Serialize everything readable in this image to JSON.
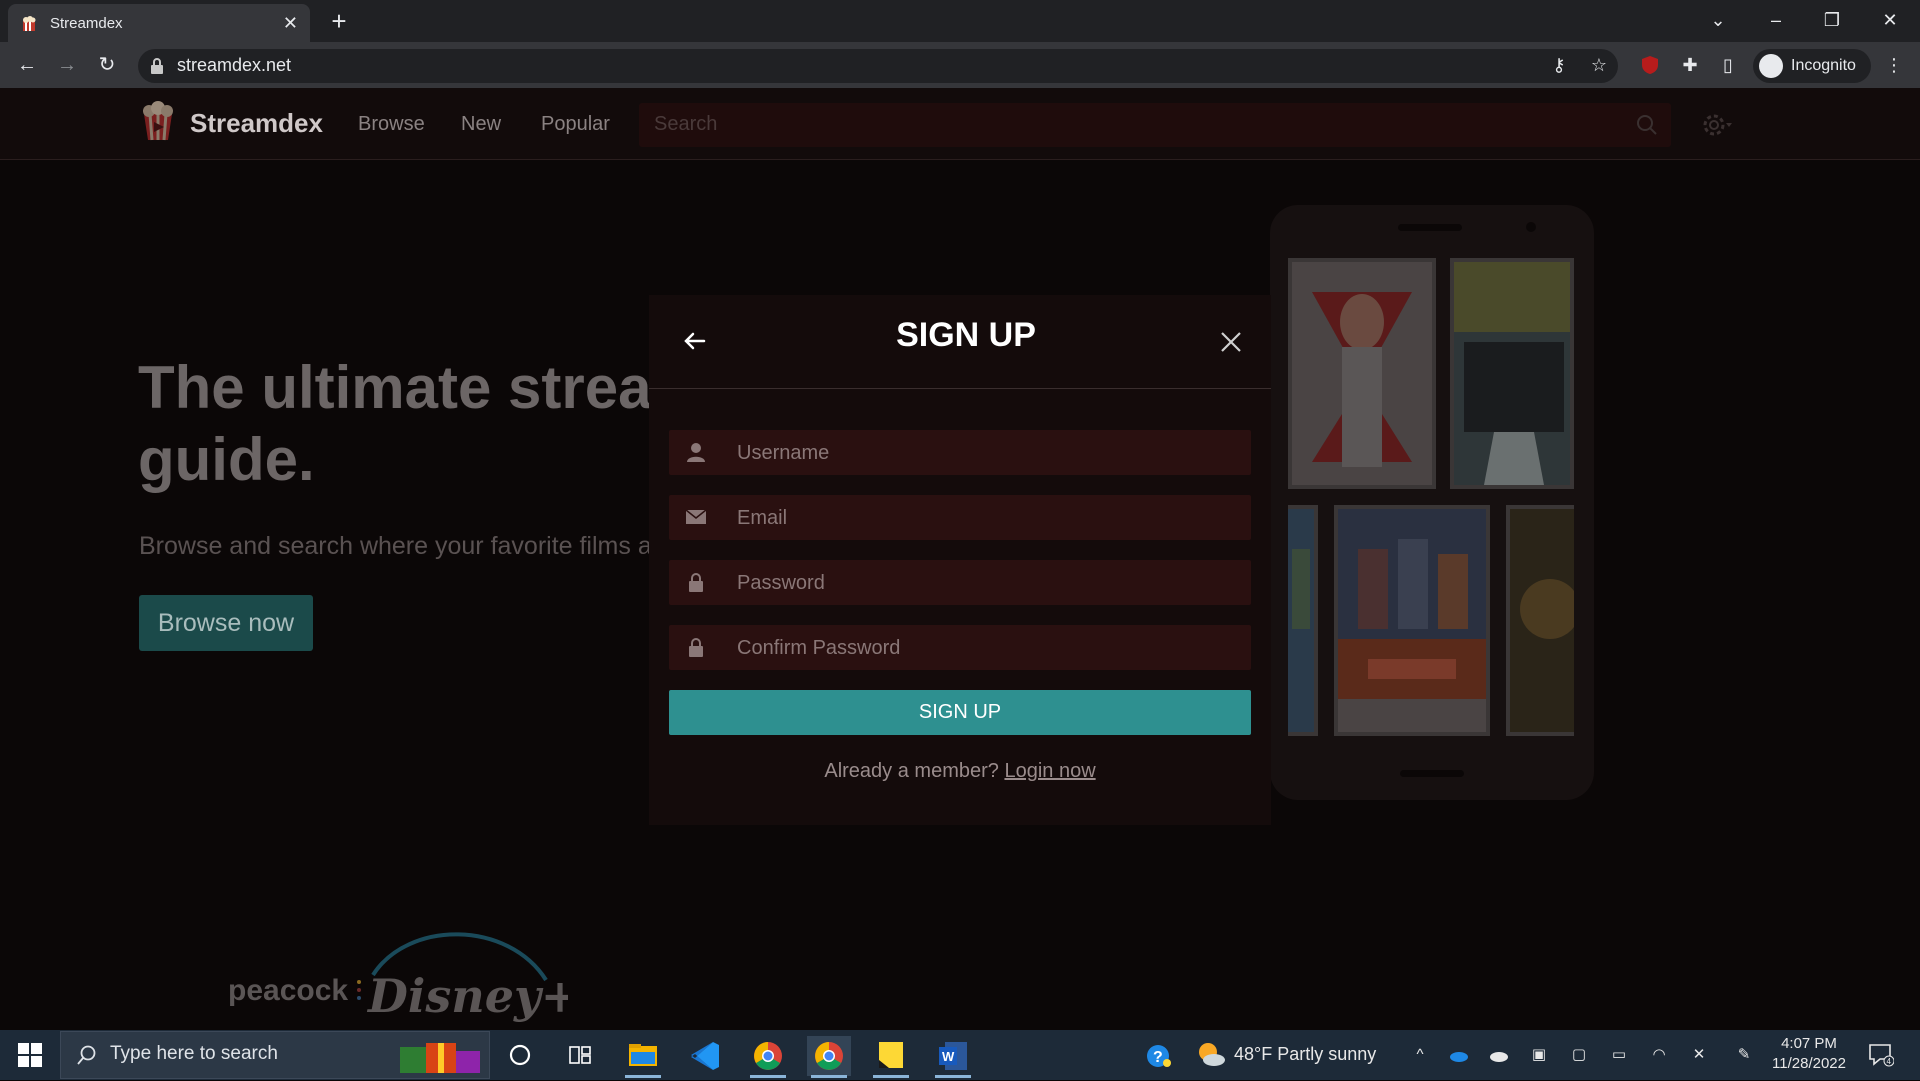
{
  "browser": {
    "tab_title": "Streamdex",
    "url": "streamdex.net",
    "profile_label": "Incognito"
  },
  "site": {
    "brand": "Streamdex",
    "nav": [
      "Browse",
      "New",
      "Popular"
    ],
    "search_placeholder": "Search",
    "hero_title_line1": "The ultimate strea",
    "hero_title_line2": "guide.",
    "hero_subtitle": "Browse and search where your favorite films a",
    "browse_button": "Browse now",
    "brand_logos": [
      "peacock",
      "Disney+"
    ]
  },
  "modal": {
    "title": "SIGN UP",
    "fields": [
      {
        "placeholder": "Username",
        "icon": "user-icon"
      },
      {
        "placeholder": "Email",
        "icon": "envelope-icon"
      },
      {
        "placeholder": "Password",
        "icon": "lock-icon"
      },
      {
        "placeholder": "Confirm Password",
        "icon": "lock-icon"
      }
    ],
    "submit_label": "SIGN UP",
    "member_text": "Already a member?",
    "login_link": "Login now"
  },
  "taskbar": {
    "search_placeholder": "Type here to search",
    "weather": "48°F  Partly sunny",
    "time": "4:07 PM",
    "date": "11/28/2022",
    "notification_count": "4"
  },
  "colors": {
    "accent": "#2e9090",
    "modal_bg": "#140b0b",
    "field_bg": "#2a1010"
  }
}
